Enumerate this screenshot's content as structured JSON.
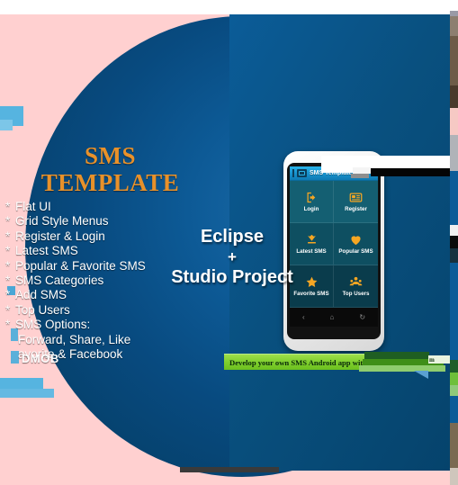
{
  "colors": {
    "background_pink": "#ffd0d0",
    "circle_blue": "#0d5a96",
    "title_orange": "#e8912a",
    "banner_green": "#7fcf2e",
    "tile_accent_orange": "#f5a623",
    "appbar_blue": "#1894cf",
    "text_white": "#ffffff"
  },
  "promo": {
    "title_line1": "SMS",
    "title_line2": "TEMPLATE",
    "features": [
      {
        "bullet": "*",
        "label": "Flat UI"
      },
      {
        "bullet": "*",
        "label": "Grid Style Menus"
      },
      {
        "bullet": "*",
        "label": "Register & Login"
      },
      {
        "bullet": "*",
        "label": "Latest SMS"
      },
      {
        "bullet": "*",
        "label": "Popular & Favorite SMS"
      },
      {
        "bullet": "*",
        "label": "SMS Categories"
      },
      {
        "bullet": "*",
        "label": "Add SMS"
      },
      {
        "bullet": "*",
        "label": "Top Users"
      },
      {
        "bullet": "*",
        "label": "SMS Options:"
      }
    ],
    "feature_sub_lines": [
      "Forward, Share, Like",
      "avorite & Facebook"
    ],
    "admob_label": "DMOB",
    "center": {
      "line1": "Eclipse",
      "plus": "+",
      "line2": "Studio Project"
    },
    "banner_text": "Develop your own SMS Android app with SMS Templ",
    "banner_tail_text": "m"
  },
  "phone": {
    "brand": "_____",
    "app": {
      "appbar_title": "SMS Template",
      "menu_icon": "app-logo-icon",
      "tiles": [
        {
          "label": "Login",
          "icon": "login-arrow-icon",
          "row": "r1"
        },
        {
          "label": "Register",
          "icon": "register-card-icon",
          "row": "r1"
        },
        {
          "label": "Latest SMS",
          "icon": "download-arrow-icon",
          "row": "r2"
        },
        {
          "label": "Popular SMS",
          "icon": "heart-icon",
          "row": "r2"
        },
        {
          "label": "Favorite SMS",
          "icon": "star-icon",
          "row": "r3"
        },
        {
          "label": "Top Users",
          "icon": "people-group-icon",
          "row": "r3"
        }
      ]
    },
    "navbar": [
      {
        "name": "back-button",
        "glyph": "‹"
      },
      {
        "name": "home-button",
        "glyph": "⌂"
      },
      {
        "name": "recents-button",
        "glyph": "↻"
      }
    ]
  }
}
